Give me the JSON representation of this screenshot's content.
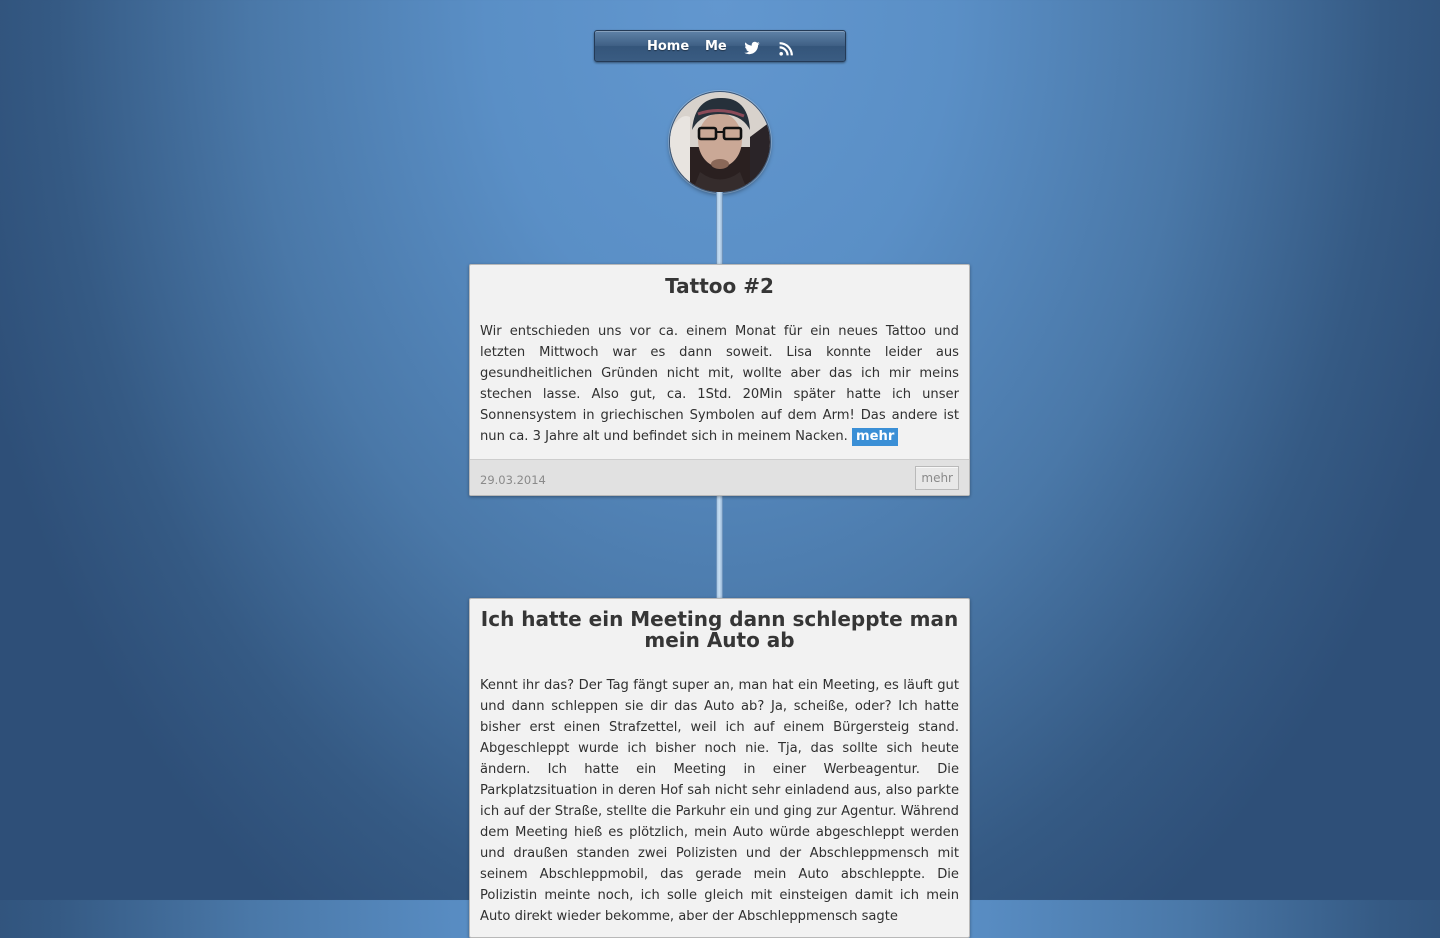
{
  "nav": {
    "home_label": "Home",
    "me_label": "Me",
    "icons": [
      "twitter-icon",
      "rss-icon"
    ]
  },
  "posts": [
    {
      "title": "Tattoo #2",
      "body": "Wir entschieden uns vor ca. einem Monat für ein neues Tattoo und letzten Mittwoch war es dann soweit. Lisa konnte leider aus gesundheitlichen Gründen nicht mit, wollte aber das ich mir meins stechen lasse. Also gut, ca. 1Std. 20Min später hatte ich unser Sonnensystem in griechischen Symbolen auf dem Arm! Das andere ist nun ca. 3 Jahre alt und befindet sich in meinem Nacken.",
      "more_inline": "mehr",
      "date": "29.03.2014",
      "more_button": "mehr"
    },
    {
      "title": "Ich hatte ein Meeting dann schleppte man mein Auto ab",
      "body": "Kennt ihr das? Der Tag fängt super an, man hat ein Meeting, es läuft gut und dann schleppen sie dir das Auto ab? Ja, scheiße, oder? Ich hatte bisher erst einen Strafzettel, weil ich auf einem Bürgersteig stand. Abgeschleppt wurde ich bisher noch nie. Tja, das sollte sich heute ändern. Ich hatte ein Meeting in einer Werbeagentur. Die Parkplatzsituation in deren Hof sah nicht sehr einladend aus, also parkte ich auf der Straße, stellte die Parkuhr ein und ging zur Agentur. Während dem Meeting hieß es plötzlich, mein Auto würde abgeschleppt werden und draußen standen zwei Polizisten und der Abschleppmensch mit seinem Abschleppmobil, das gerade mein Auto abschleppte. Die Polizistin meinte noch, ich solle gleich mit einsteigen damit ich mein Auto direkt wieder bekomme, aber der Abschleppmensch sagte"
    }
  ],
  "colors": {
    "background": "#5a8fc6",
    "accent": "#3a8fd6",
    "card": "#f2f2f2"
  }
}
